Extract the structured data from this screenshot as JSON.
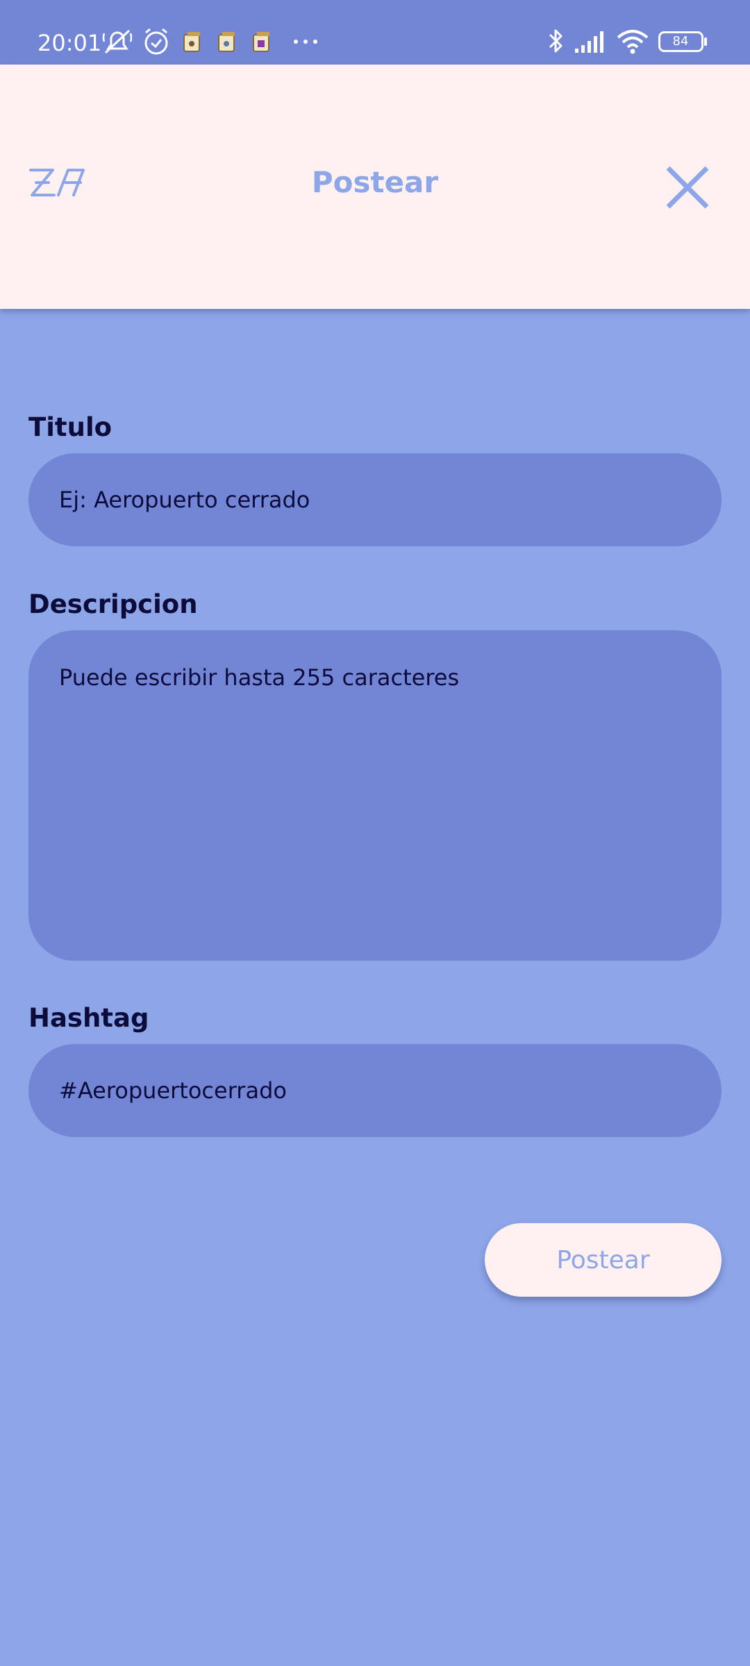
{
  "status_bar": {
    "time": "20:01",
    "battery": "84",
    "icons": [
      "mute-icon",
      "alarm-icon",
      "app-notification-icon",
      "app-notification-icon",
      "app-notification-icon",
      "more-dots-icon",
      "bluetooth-icon",
      "signal-icon",
      "wifi-icon",
      "battery-icon"
    ]
  },
  "header": {
    "title": "Postear",
    "logo_icon": "app-logo-icon",
    "close_icon": "close-icon"
  },
  "form": {
    "title_label": "Titulo",
    "title_placeholder": "Ej: Aeropuerto cerrado",
    "description_label": "Descripcion",
    "description_placeholder": "Puede escribir hasta 255 caracteres",
    "hashtag_label": "Hashtag",
    "hashtag_placeholder": "#Aeropuertocerrado",
    "submit_label": "Postear"
  },
  "colors": {
    "background": "#8da6e8",
    "status_bar": "#7386d5",
    "header": "#fff1f1",
    "field": "#7386d5",
    "label_text": "#0d0b3a",
    "accent": "#8da6e8"
  }
}
